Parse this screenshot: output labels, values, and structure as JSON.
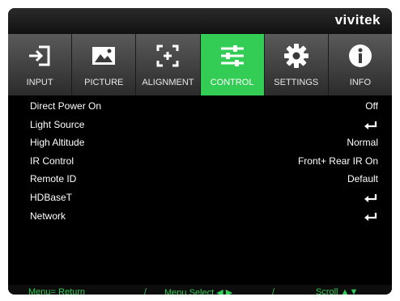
{
  "brand": "vivitek",
  "tabs": [
    {
      "label": "INPUT",
      "icon": "input-icon"
    },
    {
      "label": "PICTURE",
      "icon": "picture-icon"
    },
    {
      "label": "ALIGNMENT",
      "icon": "alignment-icon"
    },
    {
      "label": "CONTROL",
      "icon": "control-sliders-icon",
      "active": true
    },
    {
      "label": "SETTINGS",
      "icon": "gear-icon"
    },
    {
      "label": "INFO",
      "icon": "info-icon"
    }
  ],
  "menu": [
    {
      "name": "Direct Power On",
      "value": "Off"
    },
    {
      "name": "Light Source",
      "value": null
    },
    {
      "name": "High Altitude",
      "value": "Normal"
    },
    {
      "name": "IR Control",
      "value": "Front+ Rear IR On"
    },
    {
      "name": "Remote ID",
      "value": "Default"
    },
    {
      "name": "HDBaseT",
      "value": null
    },
    {
      "name": "Network",
      "value": null
    }
  ],
  "footer": {
    "menu_return": "Menu= Return",
    "sep1": "/",
    "menu_select": "Menu Select ◀ ▶",
    "sep2": "/",
    "scroll": "Scroll ▲▼"
  },
  "colors": {
    "accent": "#33cc55",
    "background": "#000000",
    "tab_inactive": "#4a4a4a"
  }
}
